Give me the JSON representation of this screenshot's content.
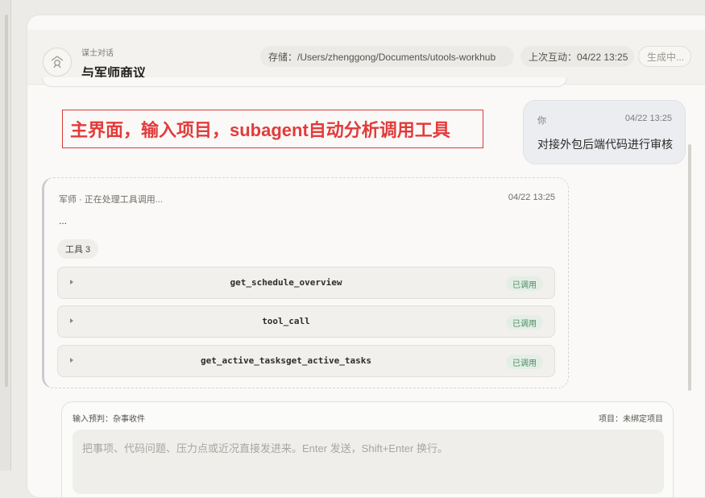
{
  "header": {
    "eyebrow": "谋士对话",
    "title": "与军师商议",
    "storage": "存储：/Users/zhenggong/Documents/utools-workhub",
    "last_interaction": "上次互动：04/22 13:25",
    "status": "生成中..."
  },
  "annotation": {
    "text": "主界面，输入项目，subagent自动分析调用工具",
    "color": "#e23b3b"
  },
  "user_message": {
    "sender": "你",
    "time": "04/22 13:25",
    "text": "对接外包后端代码进行审核"
  },
  "assistant_message": {
    "meta": "军师 · 正在处理工具调用...",
    "time": "04/22 13:25",
    "body": "...",
    "tool_chip": "工具 3",
    "tools": [
      {
        "name": "get_schedule_overview",
        "status": "已调用"
      },
      {
        "name": "tool_call",
        "status": "已调用"
      },
      {
        "name": "get_active_tasksget_active_tasks",
        "status": "已调用"
      }
    ]
  },
  "composer": {
    "intent": "输入预判：杂事收件",
    "project": "项目：未绑定项目",
    "placeholder": "把事项、代码问题、压力点或近况直接发进来。Enter 发送，Shift+Enter 换行。"
  }
}
